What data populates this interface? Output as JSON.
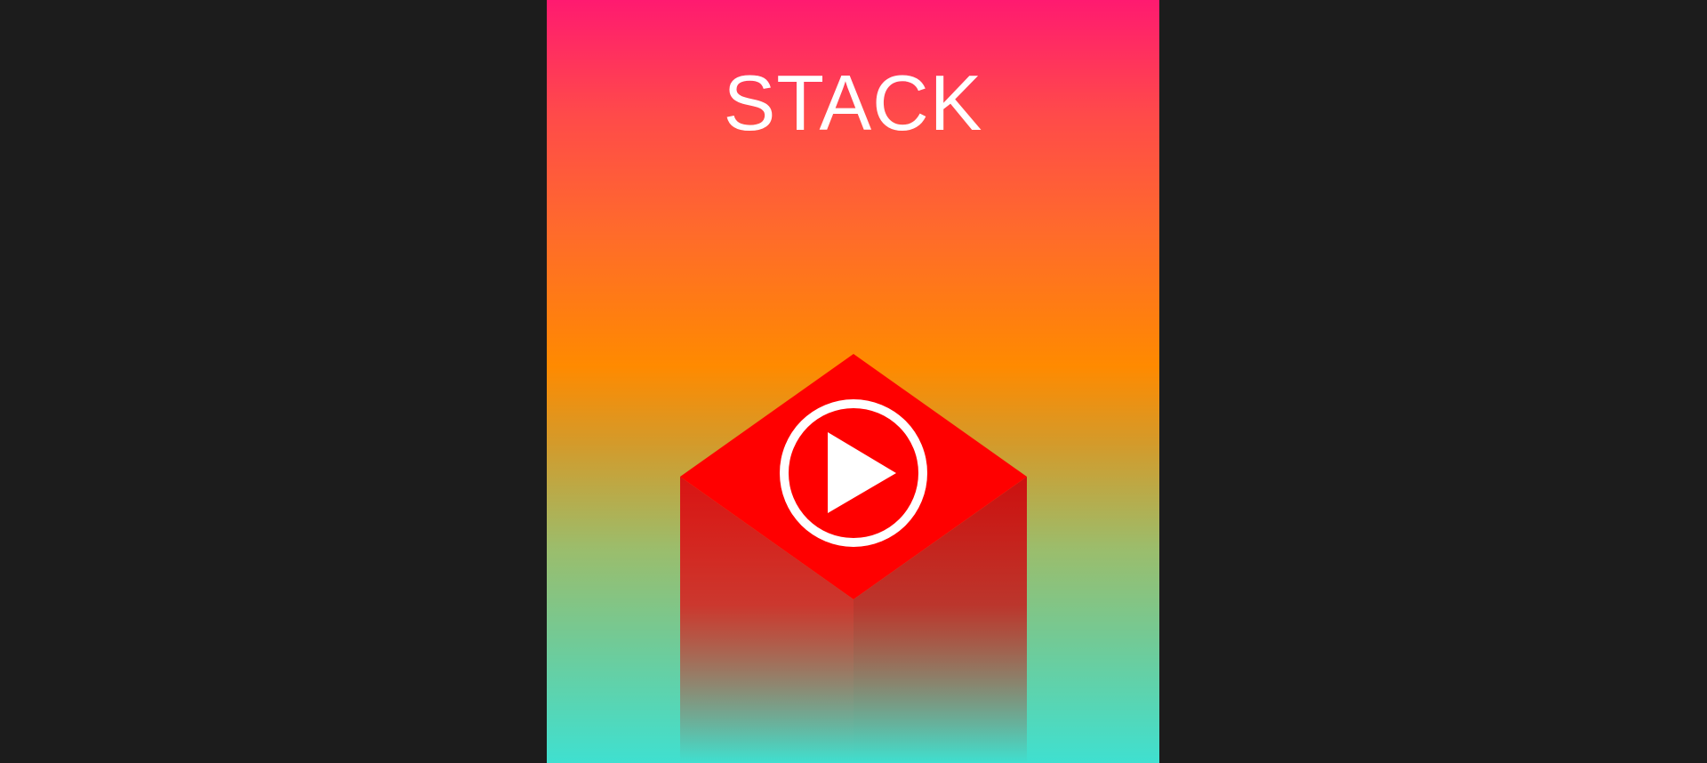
{
  "game": {
    "title": "STACK"
  },
  "colors": {
    "page_background": "#1c1c1c",
    "gradient_top": "#ff1a70",
    "gradient_middle": "#ff8a00",
    "gradient_bottom": "#3fe0d0",
    "block_top": "#ff0000",
    "block_side": "#d81818",
    "logo": "#ffffff"
  },
  "block": {
    "logo_icon": "play-circle-icon"
  }
}
